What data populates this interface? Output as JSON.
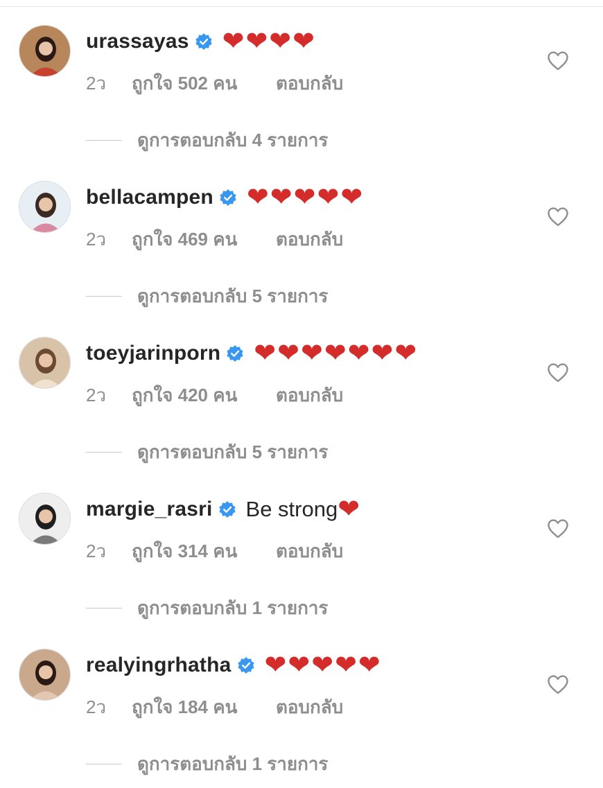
{
  "colors": {
    "heart": "#d42b2b",
    "verified": "#3897f0",
    "muted": "#8e8e8e"
  },
  "comments": [
    {
      "username": "urassayas",
      "verified": true,
      "text": "",
      "hearts": 4,
      "time": "2ว",
      "likes": "ถูกใจ 502 คน",
      "reply": "ตอบกลับ",
      "view_replies": "ดูการตอบกลับ 4 รายการ"
    },
    {
      "username": "bellacampen",
      "verified": true,
      "text": "",
      "hearts": 5,
      "time": "2ว",
      "likes": "ถูกใจ 469 คน",
      "reply": "ตอบกลับ",
      "view_replies": "ดูการตอบกลับ 5 รายการ"
    },
    {
      "username": "toeyjarinporn",
      "verified": true,
      "text": "",
      "hearts": 7,
      "time": "2ว",
      "likes": "ถูกใจ 420 คน",
      "reply": "ตอบกลับ",
      "view_replies": "ดูการตอบกลับ 5 รายการ"
    },
    {
      "username": "margie_rasri",
      "verified": true,
      "text": "Be strong",
      "hearts": 1,
      "time": "2ว",
      "likes": "ถูกใจ 314 คน",
      "reply": "ตอบกลับ",
      "view_replies": "ดูการตอบกลับ 1 รายการ"
    },
    {
      "username": "realyingrhatha",
      "verified": true,
      "text": "",
      "hearts": 5,
      "time": "2ว",
      "likes": "ถูกใจ 184 คน",
      "reply": "ตอบกลับ",
      "view_replies": "ดูการตอบกลับ 1 รายการ"
    }
  ]
}
